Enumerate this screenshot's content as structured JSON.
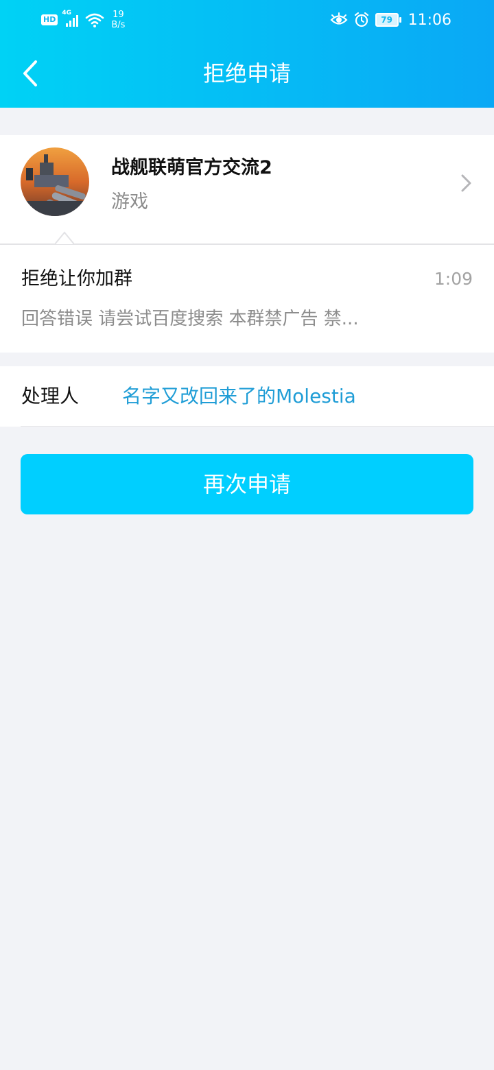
{
  "status_bar": {
    "hd_badge": "HD",
    "network_type": "4G",
    "speed_value": "19",
    "speed_unit": "B/s",
    "battery_level": "79",
    "time": "11:06",
    "icons": [
      "hd-icon",
      "signal-icon",
      "wifi-icon",
      "eye-icon",
      "alarm-icon",
      "battery-icon"
    ]
  },
  "header": {
    "title": "拒绝申请",
    "back_icon": "chevron-left-icon",
    "gradient_start": "#00d2f5",
    "gradient_end": "#0aa8f5"
  },
  "group": {
    "name": "战舰联萌官方交流2",
    "category": "游戏",
    "avatar_icon": "battleship-avatar",
    "chevron_icon": "chevron-right-icon"
  },
  "rejection": {
    "title": "拒绝让你加群",
    "time": "1:09",
    "reason": "回答错误 请尝试百度搜索 本群禁广告 禁..."
  },
  "handler": {
    "label": "处理人",
    "name": "名字又改回来了的Molestia",
    "name_color": "#1f9dd6"
  },
  "action": {
    "reapply_label": "再次申请",
    "button_color": "#00cfff"
  }
}
